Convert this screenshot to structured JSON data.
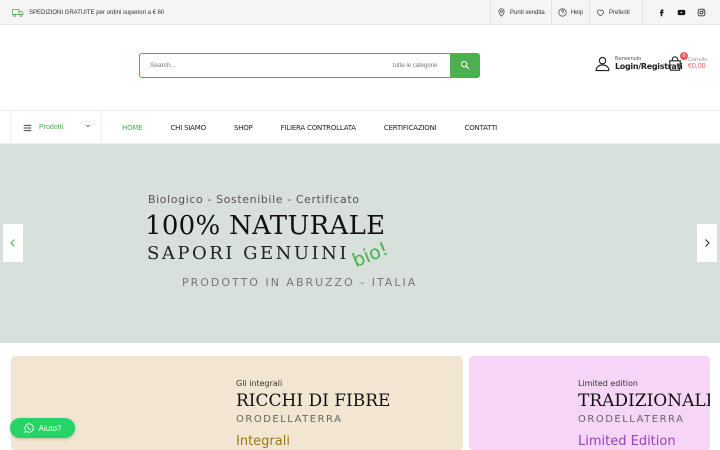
{
  "topbar": {
    "shipping_text": "SPEDIZIONI GRATUITE per ordini superiori a € 60",
    "links": [
      {
        "label": "Punti vendita",
        "icon": "map-pin-icon"
      },
      {
        "label": "Help",
        "icon": "help-circle-icon"
      },
      {
        "label": "Preferiti",
        "icon": "heart-icon"
      }
    ],
    "social": [
      "facebook-icon",
      "youtube-icon",
      "instagram-icon"
    ]
  },
  "header": {
    "search": {
      "placeholder": "Search...",
      "category": "tutte le categorie"
    },
    "account": {
      "welcome": "Benvenuto",
      "login": "Login/Registrati"
    },
    "cart": {
      "label": "Carrello",
      "total": "€0,00",
      "count": "0"
    }
  },
  "nav": {
    "products_label": "Prodotti",
    "items": [
      {
        "label": "HOME",
        "active": true
      },
      {
        "label": "CHI SIAMO",
        "active": false
      },
      {
        "label": "SHOP",
        "active": false
      },
      {
        "label": "FILIERA CONTROLLATA",
        "active": false
      },
      {
        "label": "CERTIFICAZIONI",
        "active": false
      },
      {
        "label": "CONTATTI",
        "active": false
      }
    ]
  },
  "hero": {
    "kicker": "Biologico - Sostenibile - Certificato",
    "headline": "100% NATURALE",
    "subheadline": "SAPORI GENUINI",
    "bio_tag": "bio!",
    "origin": "PRODOTTO IN ABRUZZO - ITALIA"
  },
  "promos": [
    {
      "small": "Gli integrali",
      "title": "RICCHI DI FIBRE",
      "brand": "ORODELLATERRA",
      "category": "Integrali"
    },
    {
      "small": "Limited edition",
      "title": "TRADIZIONALI",
      "brand": "ORODELLATERRA",
      "category": "Limited Edition"
    }
  ],
  "help_button": {
    "label": "Aiuto?"
  },
  "colors": {
    "accent": "#4caf50",
    "hero_bg": "#d8e0db",
    "card1_bg": "#f2e6d2",
    "card2_bg": "#f6d6f7",
    "cart_price": "#e85a5a",
    "whatsapp": "#25d366"
  }
}
